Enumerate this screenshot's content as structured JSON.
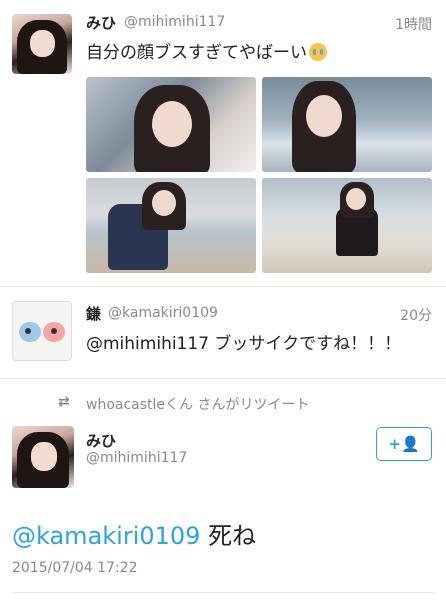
{
  "tweets": [
    {
      "name": "みひ",
      "handle": "@mihimihi117",
      "time": "1時間",
      "text": "自分の顔ブスすぎてやばーい",
      "emoji": "loudly-crying-face-emoji",
      "photo_count": 4
    },
    {
      "name": "鎌",
      "handle": "@kamakiri0109",
      "time": "20分",
      "text": "@mihimihi117 ブッサイクですね！！！"
    }
  ],
  "retweet": {
    "icon": "retweet-icon",
    "label": "whoacastleくん さんがリツイート"
  },
  "detail": {
    "name": "みひ",
    "handle": "@mihimihi117",
    "follow_icon": "add-user-icon",
    "mention": "@kamakiri0109",
    "text": " 死ね",
    "timestamp": "2015/07/04 17:22"
  },
  "colors": {
    "accent": "#2aa3ef",
    "meta": "#8a8a8a",
    "text": "#222222"
  }
}
